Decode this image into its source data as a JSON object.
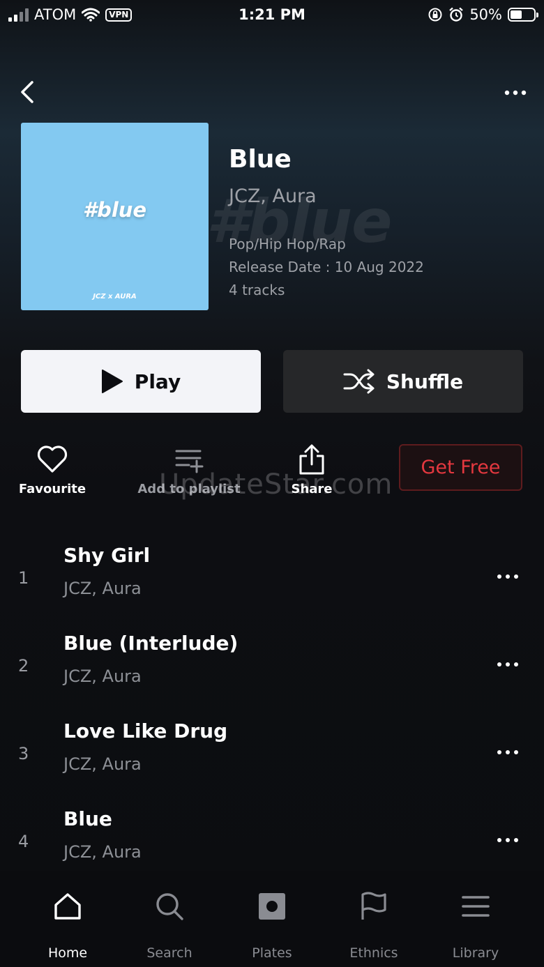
{
  "status_bar": {
    "carrier": "ATOM",
    "vpn": "VPN",
    "time": "1:21 PM",
    "battery": "50%"
  },
  "album": {
    "cover_text": "#blue",
    "cover_subtext": "JCZ x AURA",
    "title": "Blue",
    "artist": "JCZ, Aura",
    "genre": "Pop/Hip Hop/Rap",
    "release": "Release Date : 10 Aug 2022",
    "tracks_count": "4 tracks"
  },
  "buttons": {
    "play": "Play",
    "shuffle": "Shuffle"
  },
  "actions": {
    "favourite": "Favourite",
    "add_to_playlist": "Add to playlist",
    "share": "Share",
    "get_free": "Get Free"
  },
  "watermark": "UpdateStar.com",
  "tracks": [
    {
      "num": "1",
      "title": "Shy Girl",
      "artist": "JCZ, Aura"
    },
    {
      "num": "2",
      "title": "Blue (Interlude)",
      "artist": "JCZ, Aura"
    },
    {
      "num": "3",
      "title": "Love Like Drug",
      "artist": "JCZ, Aura"
    },
    {
      "num": "4",
      "title": "Blue",
      "artist": "JCZ, Aura"
    }
  ],
  "tabs": [
    {
      "label": "Home",
      "icon": "home-icon",
      "active": true
    },
    {
      "label": "Search",
      "icon": "search-icon",
      "active": false
    },
    {
      "label": "Plates",
      "icon": "plates-icon",
      "active": false
    },
    {
      "label": "Ethnics",
      "icon": "flag-icon",
      "active": false
    },
    {
      "label": "Library",
      "icon": "menu-icon",
      "active": false
    }
  ],
  "colors": {
    "accent_red": "#e4383f",
    "cover_blue": "#83c9f1"
  }
}
